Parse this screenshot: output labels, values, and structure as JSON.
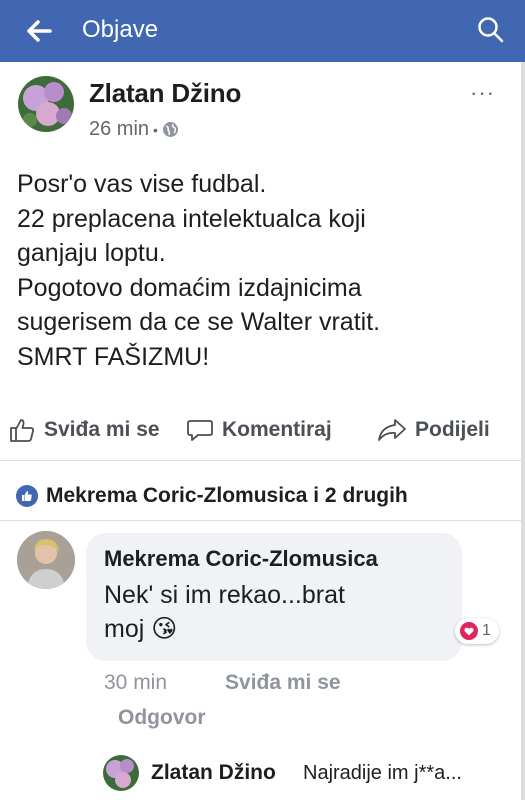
{
  "appbar": {
    "title": "Objave",
    "back_icon": "arrow-left-icon",
    "search_icon": "search-icon"
  },
  "post": {
    "author": "Zlatan Džino",
    "time": "26 min",
    "separator": "•",
    "privacy_icon": "globe-icon",
    "more_icon": "ellipsis-icon",
    "more": "···",
    "lines": [
      "Posr'o vas vise fudbal.",
      "22 preplacena intelektualca koji",
      "ganjaju loptu.",
      "Pogotovo domaćim izdajnicima",
      "sugerisem da ce se Walter vratit.",
      "SMRT FAŠIZMU!"
    ]
  },
  "actions": {
    "like": "Sviđa mi se",
    "comment": "Komentiraj",
    "share": "Podijeli"
  },
  "reactions": {
    "summary": "Mekrema Coric-Zlomusica i 2 drugih",
    "icon": "like-icon"
  },
  "comment": {
    "author": "Mekrema Coric-Zlomusica",
    "line1": "Nek' si im rekao...brat",
    "line2": "moj",
    "emoji": "😘",
    "reaction_count": "1",
    "reaction_icon": "heart-icon",
    "time": "30 min",
    "like": "Sviđa mi se",
    "reply": "Odgovor"
  },
  "reply": {
    "author": "Zlatan Džino",
    "text": "Najradije im j**a..."
  },
  "colors": {
    "brand": "#4267b2",
    "heart": "#e0245e"
  }
}
